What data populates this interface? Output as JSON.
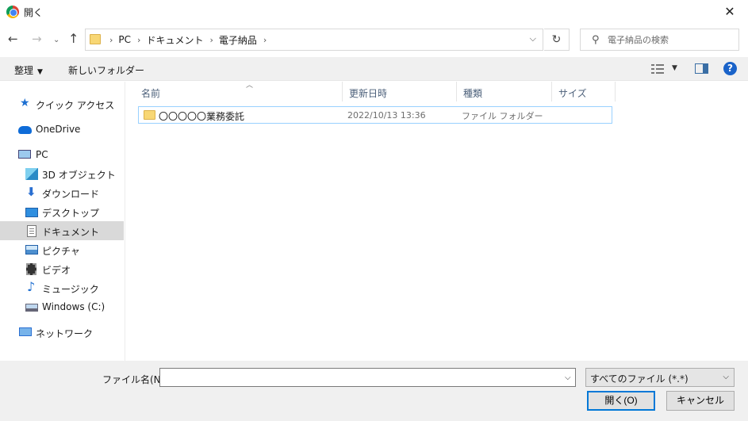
{
  "window": {
    "title": "開く"
  },
  "address": {
    "crumbs": [
      "PC",
      "ドキュメント",
      "電子納品"
    ],
    "search_placeholder": "電子納品の検索"
  },
  "toolbar": {
    "organize_label": "整理",
    "new_folder_label": "新しいフォルダー"
  },
  "sidebar": {
    "quick_access": "クイック アクセス",
    "onedrive": "OneDrive",
    "pc": "PC",
    "objects3d": "3D オブジェクト",
    "downloads": "ダウンロード",
    "desktop": "デスクトップ",
    "documents": "ドキュメント",
    "pictures": "ピクチャ",
    "videos": "ビデオ",
    "music": "ミュージック",
    "windows_c": "Windows (C:)",
    "network": "ネットワーク"
  },
  "columns": {
    "name": "名前",
    "modified": "更新日時",
    "type": "種類",
    "size": "サイズ"
  },
  "files": [
    {
      "name": "〇〇〇〇〇業務委託",
      "modified": "2022/10/13 13:36",
      "type": "ファイル フォルダー"
    }
  ],
  "bottom": {
    "filename_label": "ファイル名(N):",
    "filename_value": "",
    "filetype_selected": "すべてのファイル (*.*)",
    "open_label": "開く(O)",
    "cancel_label": "キャンセル"
  }
}
